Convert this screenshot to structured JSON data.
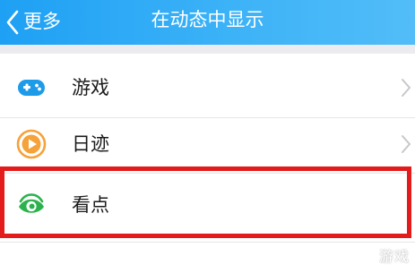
{
  "header": {
    "back_label": "更多",
    "title": "在动态中显示"
  },
  "list": {
    "items": [
      {
        "label": "游戏",
        "icon": "gamepad-icon",
        "color": "#1e9be8"
      },
      {
        "label": "日迹",
        "icon": "play-circle-icon",
        "color": "#f5a23a"
      },
      {
        "label": "看点",
        "icon": "eye-icon",
        "color": "#2bb24c"
      }
    ]
  },
  "highlight": {
    "color": "#e31b1b"
  },
  "watermark": {
    "text": "游戏"
  },
  "colors": {
    "header_blue": "#1ea0f4",
    "background": "#ececf0"
  }
}
